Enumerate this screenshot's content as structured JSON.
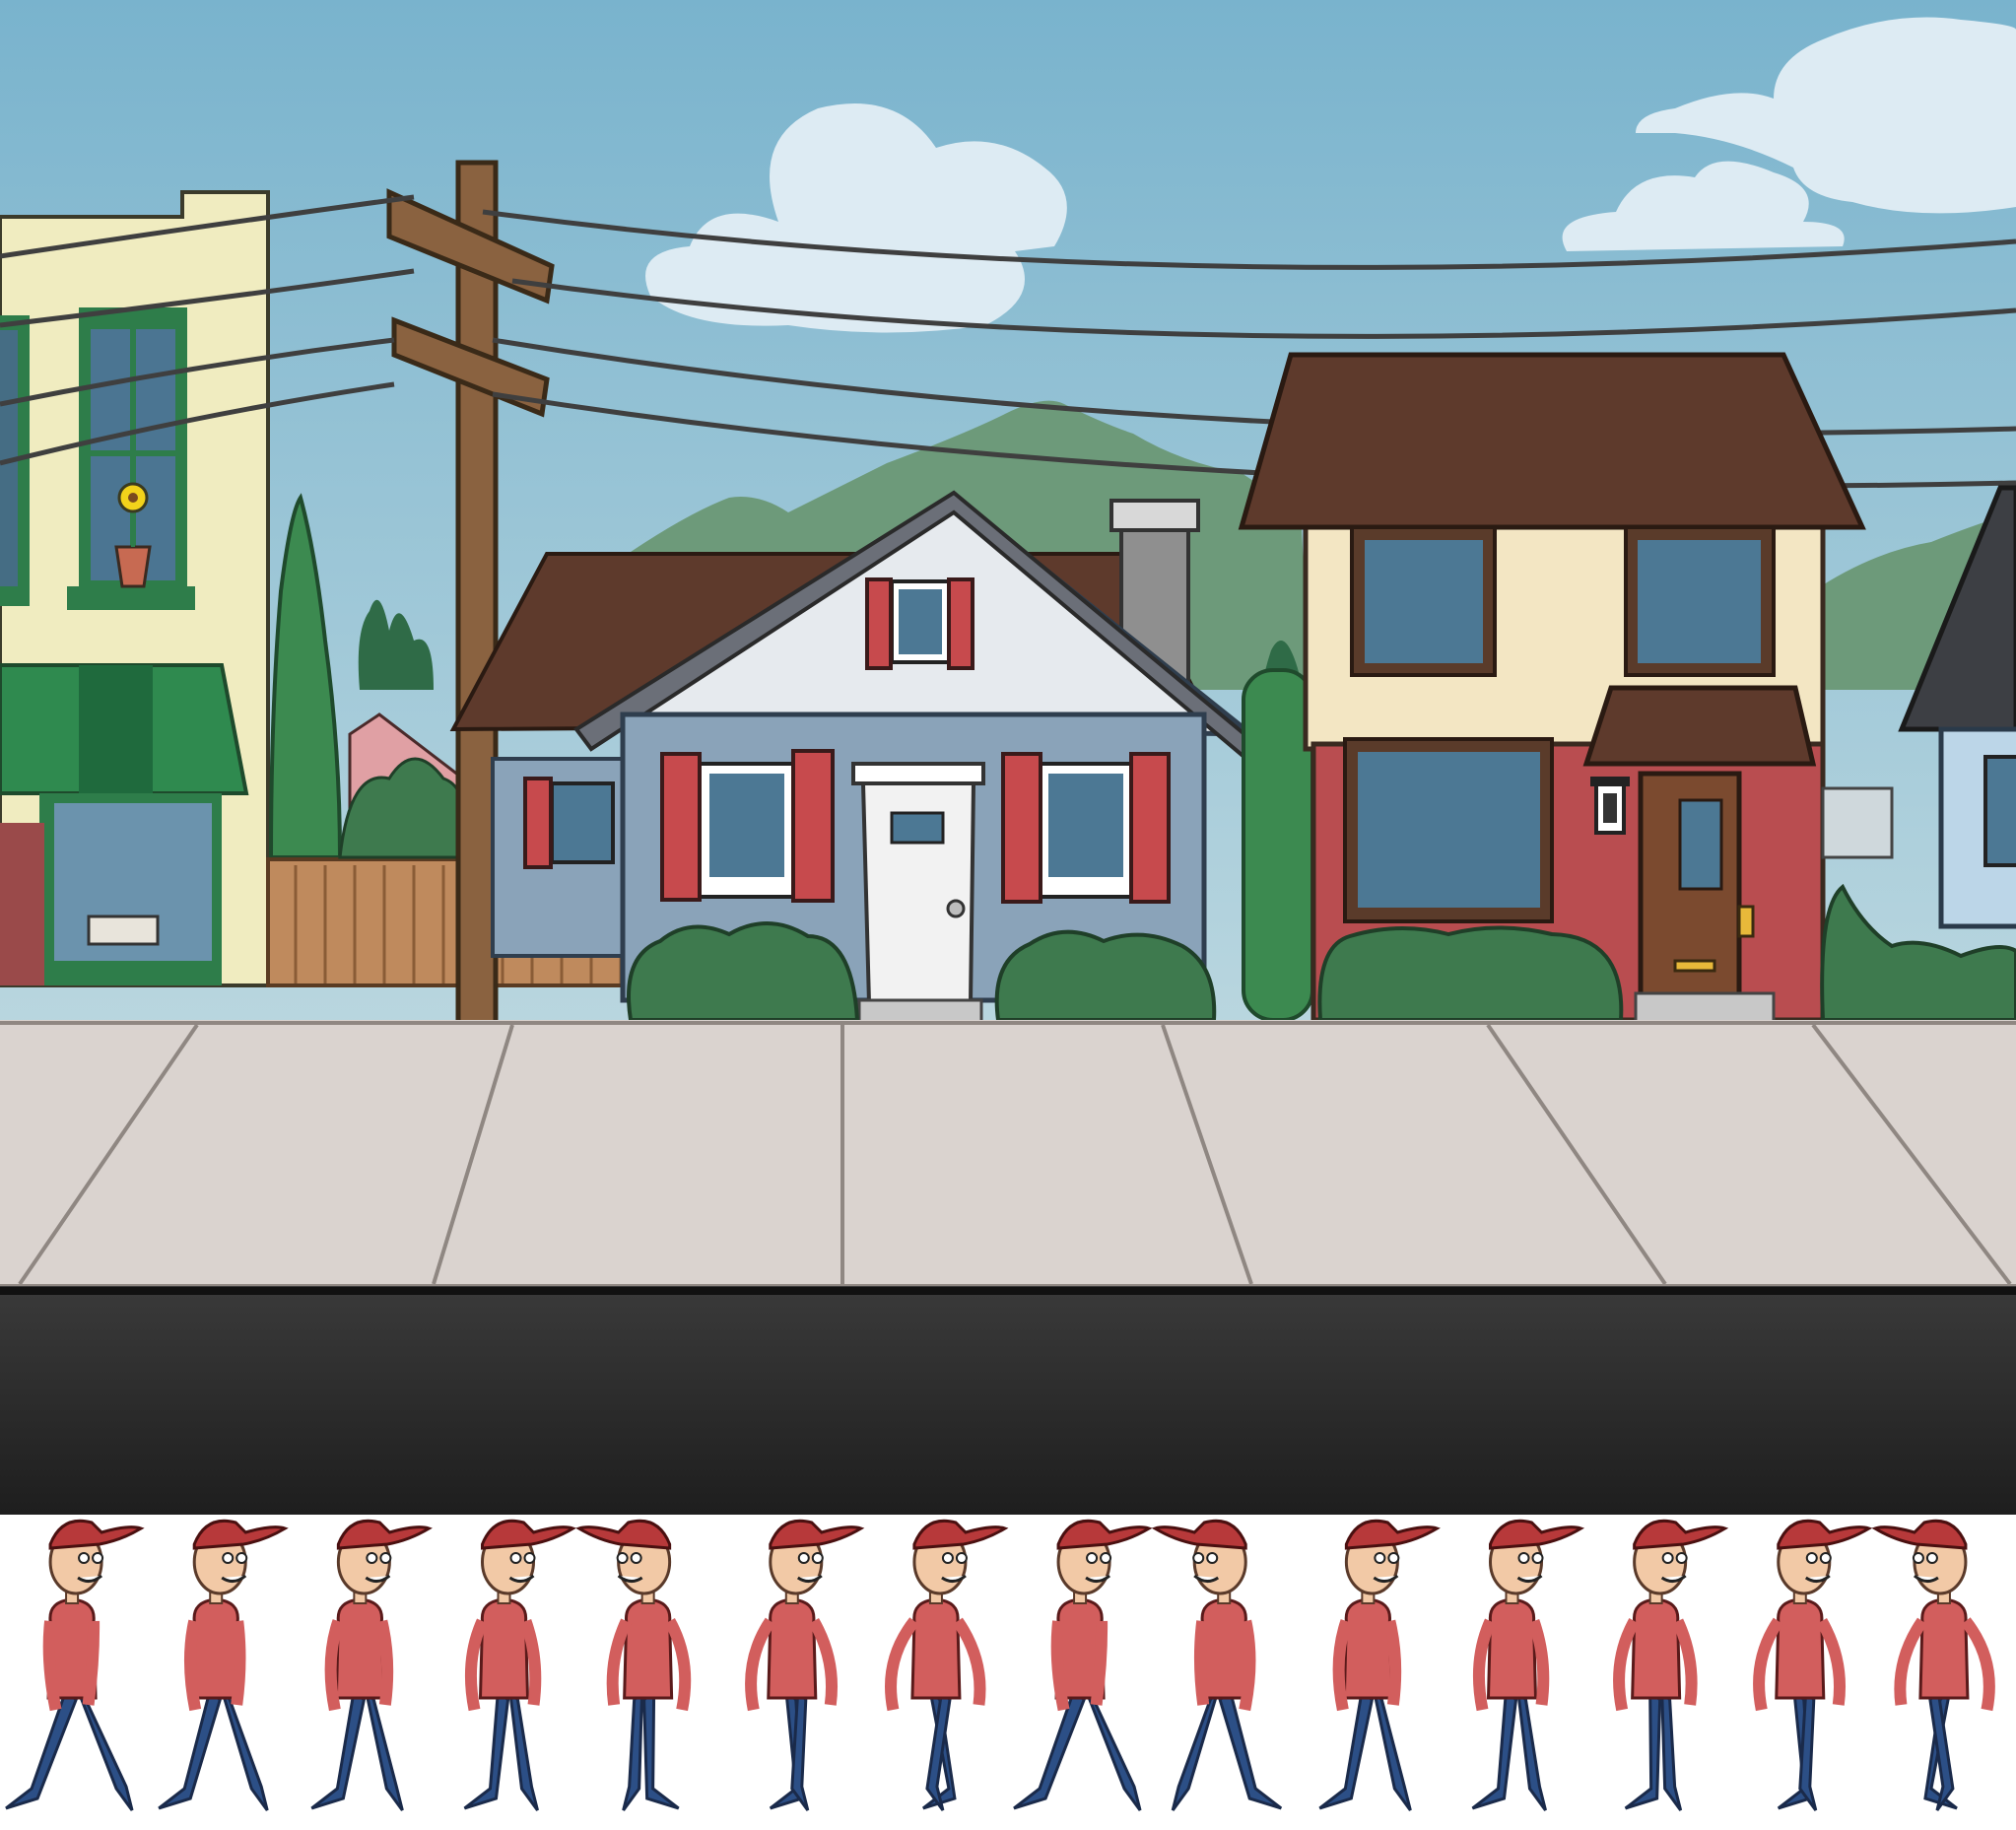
{
  "scene": {
    "type": "side-scrolling game background with character walk-cycle sprite sheet",
    "colors": {
      "sky_top": "#79b3cd",
      "sky_bottom": "#b9d6df",
      "cloud": "#ddebf3",
      "mountain": "#6d9a7a",
      "sidewalk": "#dad3cf",
      "curb_line": "#8f8782",
      "road_top": "#3a3a3a",
      "road_bottom": "#1e1e1e",
      "pole": "#8a6240",
      "wire": "#3f3f3f",
      "shop_wall": "#f0ecc0",
      "shop_trim": "#2e7d4a",
      "awning_green": "#2f8a4f",
      "fence": "#bf8a5d",
      "gray_house_wall": "#8aa3b9",
      "gray_house_gable": "#e6eaee",
      "shutter_red": "#c74a4d",
      "roof_brown": "#5e3a2c",
      "two_story_upper": "#f3e6c3",
      "two_story_lower": "#b94d50",
      "door_brown": "#7b4a2f",
      "hedge": "#3e7a4e",
      "character_cap": "#b7393a",
      "character_shirt": "#d25e5d",
      "character_jeans": "#2c4f86",
      "character_skin": "#f2c9a6"
    }
  },
  "sprites": {
    "count": 14,
    "icon": "walking-character-frame"
  }
}
